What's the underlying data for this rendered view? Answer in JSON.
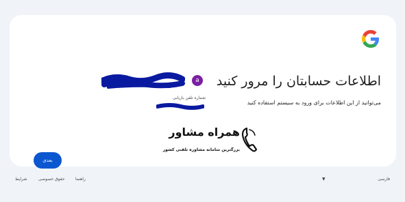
{
  "card": {
    "title": "اطلاعات حسابتان را مرور کنید",
    "subtitle": "می‌توانید از این اطلاعات برای ورود به سیستم استفاده کنید"
  },
  "account": {
    "avatar_letter": "a",
    "phone_label": "شماره تلفن بازیابی"
  },
  "actions": {
    "next_label": "بعدی"
  },
  "watermark": {
    "name": "همراه مشاور",
    "tagline": "بزرگترین سامانه مشاوره تلفنی کشور"
  },
  "footer": {
    "language": "فارسی",
    "help": "راهنما",
    "privacy": "حقوق خصوصی",
    "terms": "شرایط"
  },
  "colors": {
    "background": "#f0f4f9",
    "card": "#ffffff",
    "primary": "#0b57d0",
    "avatar": "#7b1fa2",
    "redaction": "#0a1aa0"
  },
  "icons": {
    "logo": "google-g-icon",
    "dropdown": "caret-down-icon"
  }
}
